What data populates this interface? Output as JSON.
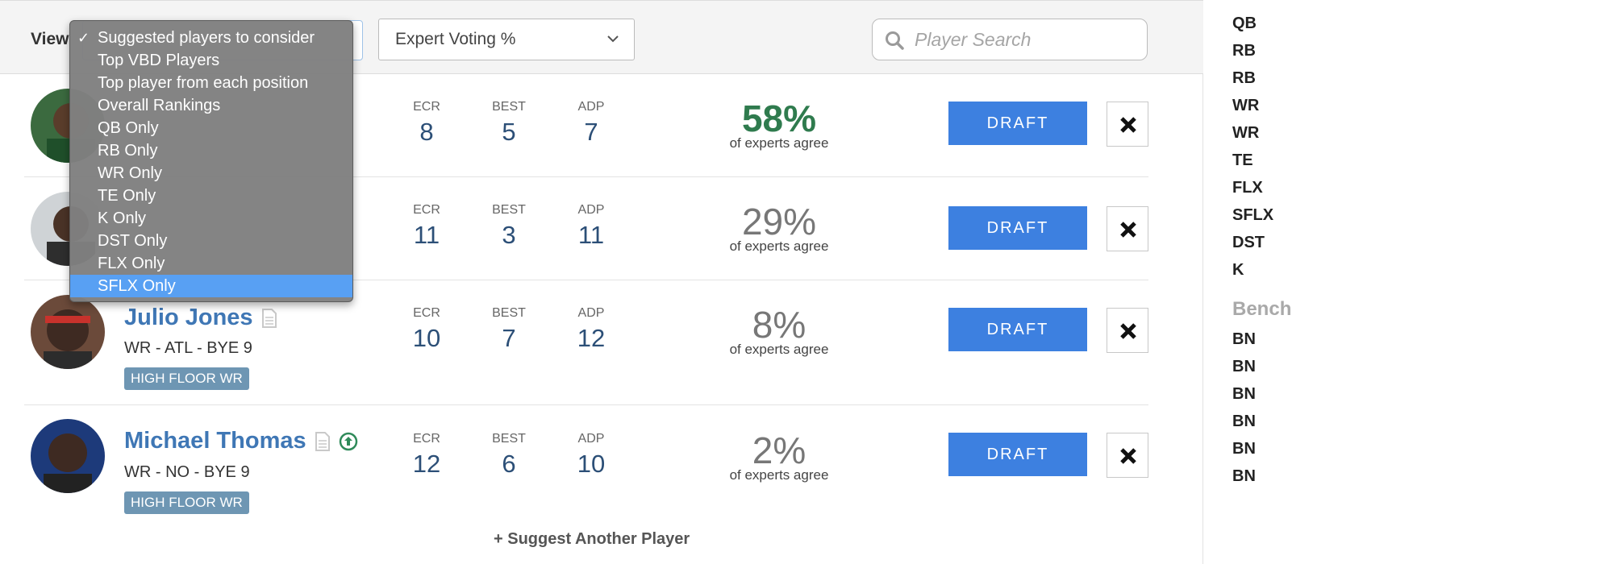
{
  "toolbar": {
    "view_label": "View",
    "sort_select_value": "Expert Voting %",
    "search_placeholder": "Player Search"
  },
  "view_menu": {
    "items": [
      {
        "label": "Suggested players to consider",
        "checked": true
      },
      {
        "label": "Top VBD Players"
      },
      {
        "label": "Top player from each position"
      },
      {
        "label": "Overall Rankings"
      },
      {
        "label": "QB Only"
      },
      {
        "label": "RB Only"
      },
      {
        "label": "WR Only"
      },
      {
        "label": "TE Only"
      },
      {
        "label": "K Only"
      },
      {
        "label": "DST Only"
      },
      {
        "label": "FLX Only"
      },
      {
        "label": "SFLX Only",
        "highlighted": true
      }
    ],
    "check_glyph": "✓"
  },
  "stat_labels": {
    "ecr": "ECR",
    "best": "BEST",
    "adp": "ADP"
  },
  "players": [
    {
      "ecr": "8",
      "best": "5",
      "adp": "7",
      "agree_pct": "58%",
      "agree_text": "of experts agree",
      "draft_label": "DRAFT"
    },
    {
      "ecr": "11",
      "best": "3",
      "adp": "11",
      "agree_pct": "29%",
      "agree_text": "of experts agree",
      "draft_label": "DRAFT"
    },
    {
      "name": "Julio Jones",
      "info": "WR - ATL - BYE 9",
      "tag": "HIGH FLOOR WR",
      "ecr": "10",
      "best": "7",
      "adp": "12",
      "agree_pct": "8%",
      "agree_text": "of experts agree",
      "draft_label": "DRAFT"
    },
    {
      "name": "Michael Thomas",
      "info": "WR - NO - BYE 9",
      "tag": "HIGH FLOOR WR",
      "ecr": "12",
      "best": "6",
      "adp": "10",
      "agree_pct": "2%",
      "agree_text": "of experts agree",
      "draft_label": "DRAFT"
    }
  ],
  "suggest_link": "+ Suggest Another Player",
  "roster": {
    "starters": [
      "QB",
      "RB",
      "RB",
      "WR",
      "WR",
      "TE",
      "FLX",
      "SFLX",
      "DST",
      "K"
    ],
    "bench_title": "Bench",
    "bench": [
      "BN",
      "BN",
      "BN",
      "BN",
      "BN",
      "BN"
    ]
  },
  "colors": {
    "accent_blue": "#3d80e0",
    "name_blue": "#3f77b5",
    "top_pct_green": "#2f7b4e",
    "tag_bg": "#6e96b3",
    "menu_highlight": "#58a0f3"
  },
  "icons": {
    "search": "search-icon",
    "chevron": "chevron-down-icon",
    "notes": "document-icon",
    "trend": "arrow-up-circle-icon",
    "remove": "close-icon"
  }
}
